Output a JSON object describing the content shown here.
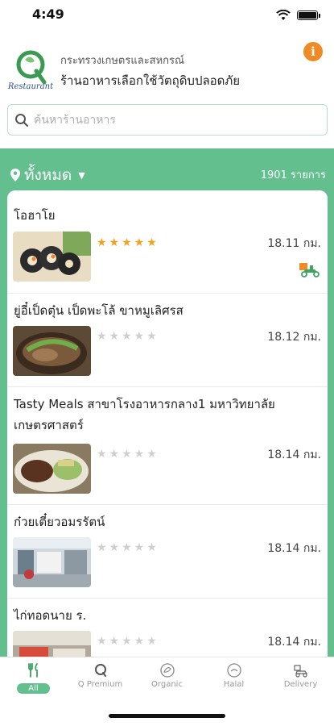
{
  "status": {
    "time": "4:49"
  },
  "header": {
    "logo_text": "Restaurant",
    "org_name": "กระทรวงเกษตรและสหกรณ์",
    "app_title": "ร้านอาหารเลือกใช้วัตถุดิบปลอดภัย",
    "info_label": "i"
  },
  "search": {
    "placeholder": "ค้นหาร้านอาหาร"
  },
  "filter": {
    "location_label": "ทั้งหมด",
    "count": "1901 รายการ"
  },
  "restaurants": [
    {
      "name": "โอฮาโย",
      "rating": 5,
      "distance": "18.11 กม.",
      "delivery": true
    },
    {
      "name": "ยู่อี๋เป็ดตุ๋น เป็ดพะโล้ ขาหมูเลิศรส",
      "rating": 0,
      "distance": "18.12 กม.",
      "delivery": false
    },
    {
      "name": "Tasty Meals สาขาโรงอาหารกลาง1 มหาวิทยาลัยเกษตรศาสตร์",
      "rating": 0,
      "distance": "18.14 กม.",
      "delivery": false
    },
    {
      "name": "ก๋วยเตี๋ยวอมรรัตน์",
      "rating": 0,
      "distance": "18.14 กม.",
      "delivery": false
    },
    {
      "name": "ไก่ทอดนาย ร.",
      "rating": 0,
      "distance": "18.14 กม.",
      "delivery": false
    }
  ],
  "tabs": [
    {
      "label": "All",
      "icon": "fork-knife-icon",
      "active": true
    },
    {
      "label": "Q Premium",
      "icon": "q-premium-icon",
      "active": false
    },
    {
      "label": "Organic",
      "icon": "organic-icon",
      "active": false
    },
    {
      "label": "Halal",
      "icon": "halal-icon",
      "active": false
    },
    {
      "label": "Delivery",
      "icon": "delivery-icon",
      "active": false
    }
  ],
  "colors": {
    "brand_green": "#63c08e",
    "star": "#f5a21b",
    "info": "#f08a24"
  }
}
